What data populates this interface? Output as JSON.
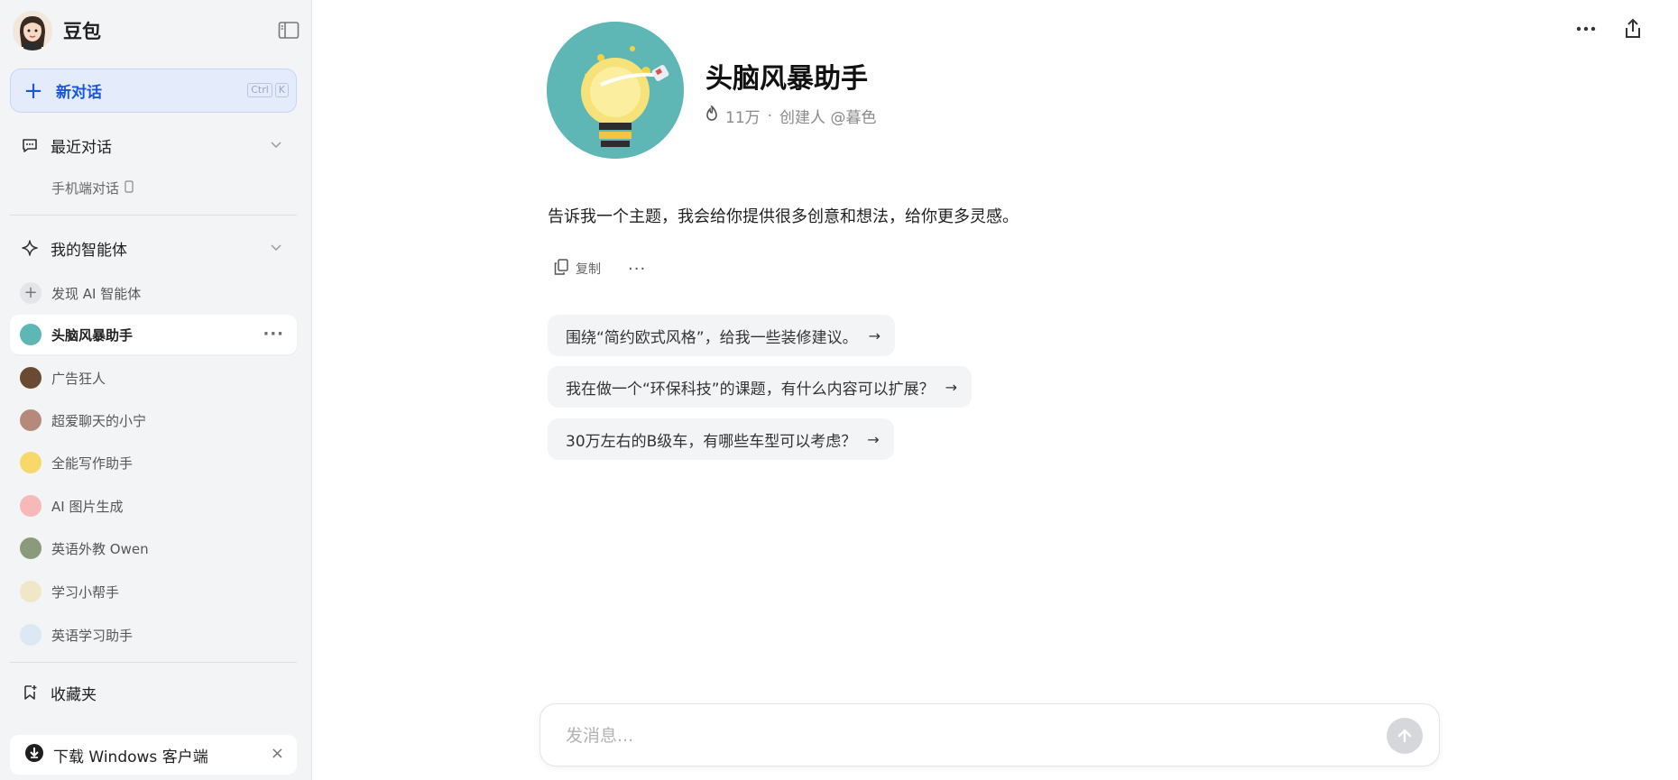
{
  "sidebar": {
    "brand": "豆包",
    "new_chat": {
      "label": "新对话",
      "shortcut": [
        "Ctrl",
        "K"
      ]
    },
    "recent": {
      "label": "最近对话",
      "sub_label": "手机端对话"
    },
    "agents_section": {
      "label": "我的智能体",
      "discover_label": "发现 AI 智能体"
    },
    "agents": [
      {
        "name": "头脑风暴助手",
        "active": true,
        "color": "#5fb7b5"
      },
      {
        "name": "广告狂人",
        "active": false,
        "color": "#6b4a33"
      },
      {
        "name": "超爱聊天的小宁",
        "active": false,
        "color": "#b58a7a"
      },
      {
        "name": "全能写作助手",
        "active": false,
        "color": "#f6d86b"
      },
      {
        "name": "AI 图片生成",
        "active": false,
        "color": "#f6b8b8"
      },
      {
        "name": "英语外教 Owen",
        "active": false,
        "color": "#8a9a7a"
      },
      {
        "name": "学习小帮手",
        "active": false,
        "color": "#f2e6c9"
      },
      {
        "name": "英语学习助手",
        "active": false,
        "color": "#dce8f4"
      }
    ],
    "favorites_label": "收藏夹",
    "download": {
      "label": "下载 Windows 客户端"
    }
  },
  "bot": {
    "title": "头脑风暴助手",
    "heat": "11万",
    "separator": "·",
    "creator": "创建人 @暮色",
    "intro": "告诉我一个主题，我会给你提供很多创意和想法，给你更多灵感。"
  },
  "message_actions": {
    "copy_label": "复制"
  },
  "suggestions": [
    "围绕“简约欧式风格”，给我一些装修建议。",
    "我在做一个“环保科技”的课题，有什么内容可以扩展？",
    "30万左右的B级车，有哪些车型可以考虑？"
  ],
  "composer": {
    "placeholder": "发消息..."
  },
  "colors": {
    "accent": "#1a56db",
    "accent_bg": "#e4ecfb",
    "sidebar_bg": "#f3f4f6"
  }
}
